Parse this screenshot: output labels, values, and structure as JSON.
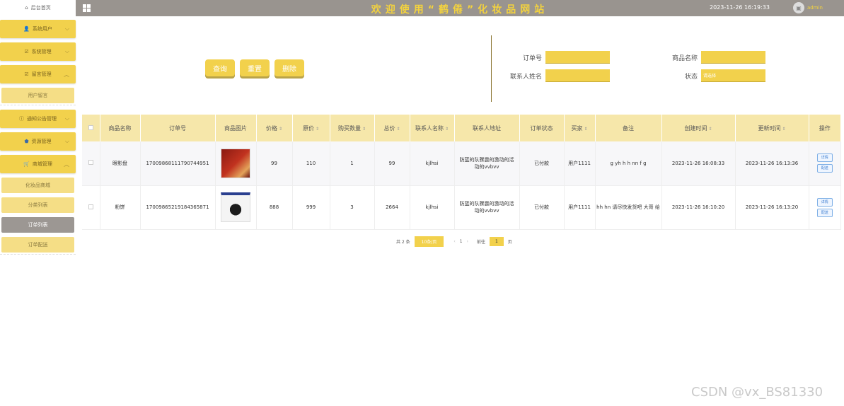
{
  "sidebar": {
    "home": "后台首页",
    "items": [
      {
        "label": "系统用户",
        "icon": "user-icon"
      },
      {
        "label": "系统管理",
        "icon": "edit-icon"
      },
      {
        "label": "留言管理",
        "icon": "edit-icon"
      },
      {
        "label": "用户留言",
        "sub": true
      },
      {
        "label": "通知公告管理",
        "icon": "info-icon"
      },
      {
        "label": "资源管理",
        "icon": "shield-icon"
      },
      {
        "label": "商城管理",
        "icon": "cart-icon"
      },
      {
        "label": "化妆品商城",
        "sub": true
      },
      {
        "label": "分类列表",
        "sub": true
      },
      {
        "label": "订单列表",
        "sub": true,
        "active": true
      },
      {
        "label": "订单配送",
        "sub": true
      }
    ]
  },
  "topbar": {
    "title": "欢迎使用“鹤倦”化妆品网站",
    "datetime": "2023-11-26 16:19:33",
    "user": "admin"
  },
  "actions": {
    "query": "查询",
    "reset": "重置",
    "delete": "删除"
  },
  "filters": {
    "order_no_label": "订单号",
    "product_name_label": "商品名称",
    "contact_name_label": "联系人姓名",
    "status_label": "状态",
    "status_value": "请选择"
  },
  "table": {
    "headers": [
      "商品名称",
      "订单号",
      "商品图片",
      "价格",
      "原价",
      "购买数量",
      "总价",
      "联系人名称",
      "联系人地址",
      "订单状态",
      "买家",
      "备注",
      "创建时间",
      "更新时间",
      "操作"
    ],
    "rows": [
      {
        "name": "眼影盘",
        "order_no": "1700986811179074495​1",
        "price": "99",
        "orig": "110",
        "qty": "1",
        "total": "99",
        "contact": "kjlhsi",
        "address": "防蓝的队骤震的激动的活动的vvbvv",
        "status": "已付款",
        "buyer": "用户1111",
        "note": "g yh h h nn f g",
        "created": "2023-11-26 16:08:33",
        "updated": "2023-11-26 16:13:36",
        "op1": "详情",
        "op2": "配送"
      },
      {
        "name": "粉饼",
        "order_no": "17009865219184365871",
        "price": "888",
        "orig": "999",
        "qty": "3",
        "total": "2664",
        "contact": "kjlhsi",
        "address": "防蓝的队骤震的激动的活动的vvbvv",
        "status": "已付款",
        "buyer": "用户1111",
        "note": "hh hn 请尽快发货吧 大哥 给",
        "created": "2023-11-26 16:10:20",
        "updated": "2023-11-26 16:13:20",
        "op1": "详情",
        "op2": "配送"
      }
    ]
  },
  "pager": {
    "total": "共 2 条",
    "size": "10条/页",
    "page": "1",
    "goto": "前往",
    "goto_page": "1",
    "goto_suffix": "页"
  },
  "watermark": "CSDN @vx_BS81330"
}
